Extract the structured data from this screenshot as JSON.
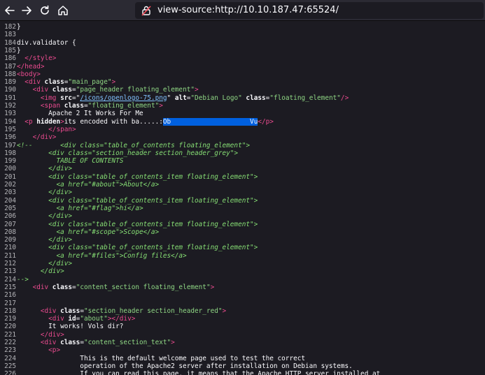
{
  "toolbar": {
    "back_icon": "arrow-left-icon",
    "forward_icon": "arrow-right-icon",
    "reload_icon": "reload-icon",
    "home_icon": "home-icon",
    "url": "view-source:http://10.10.187.47:65524/"
  },
  "source_lines": [
    {
      "n": "182",
      "segs": [
        {
          "t": "}"
        }
      ]
    },
    {
      "n": "183",
      "segs": []
    },
    {
      "n": "184",
      "segs": [
        {
          "t": "div.validator {"
        }
      ]
    },
    {
      "n": "185",
      "segs": [
        {
          "t": "}"
        }
      ]
    },
    {
      "n": "186",
      "segs": [
        {
          "t": "  "
        },
        {
          "t": "</style>",
          "c": "tag"
        }
      ]
    },
    {
      "n": "187",
      "segs": [
        {
          "t": "</head>",
          "c": "tag"
        }
      ]
    },
    {
      "n": "188",
      "segs": [
        {
          "t": "<body>",
          "c": "tag"
        }
      ]
    },
    {
      "n": "189",
      "segs": [
        {
          "t": "  "
        },
        {
          "t": "<div",
          "c": "tag"
        },
        {
          "t": " class",
          "c": "attr"
        },
        {
          "t": "="
        },
        {
          "t": "\"main_page\"",
          "c": "val"
        },
        {
          "t": ">",
          "c": "tag"
        }
      ]
    },
    {
      "n": "190",
      "segs": [
        {
          "t": "    "
        },
        {
          "t": "<div",
          "c": "tag"
        },
        {
          "t": " class",
          "c": "attr"
        },
        {
          "t": "="
        },
        {
          "t": "\"page_header floating_element\"",
          "c": "val"
        },
        {
          "t": ">",
          "c": "tag"
        }
      ]
    },
    {
      "n": "191",
      "segs": [
        {
          "t": "      "
        },
        {
          "t": "<img",
          "c": "tag"
        },
        {
          "t": " src",
          "c": "attr"
        },
        {
          "t": "=\""
        },
        {
          "t": "/icons/openlogo-75.png",
          "c": "link"
        },
        {
          "t": "\""
        },
        {
          "t": " alt",
          "c": "attr"
        },
        {
          "t": "="
        },
        {
          "t": "\"Debian Logo\"",
          "c": "val"
        },
        {
          "t": " class",
          "c": "attr"
        },
        {
          "t": "="
        },
        {
          "t": "\"floating_element\"",
          "c": "val"
        },
        {
          "t": "/>",
          "c": "tag"
        }
      ]
    },
    {
      "n": "192",
      "segs": [
        {
          "t": "      "
        },
        {
          "t": "<span",
          "c": "tag"
        },
        {
          "t": " class",
          "c": "attr"
        },
        {
          "t": "="
        },
        {
          "t": "\"floating_element\"",
          "c": "val"
        },
        {
          "t": ">",
          "c": "tag"
        }
      ]
    },
    {
      "n": "193",
      "segs": [
        {
          "t": "        Apache 2 It Works For Me"
        }
      ]
    },
    {
      "n": "194",
      "segs": [
        {
          "t": "  "
        },
        {
          "t": "<p",
          "c": "tag"
        },
        {
          "t": " hidden",
          "c": "attr"
        },
        {
          "t": ">",
          "c": "tag"
        },
        {
          "t": "its encoded with ba.....:"
        },
        {
          "t": "Ob                    Vu",
          "c": "hl"
        },
        {
          "t": "</p>",
          "c": "tag"
        }
      ]
    },
    {
      "n": "195",
      "segs": [
        {
          "t": "        "
        },
        {
          "t": "</span>",
          "c": "tag"
        }
      ]
    },
    {
      "n": "196",
      "segs": [
        {
          "t": "    "
        },
        {
          "t": "</div>",
          "c": "tag"
        }
      ]
    },
    {
      "n": "197",
      "segs": [
        {
          "t": "<!--       <div class=\"table_of_contents floating_element\">",
          "c": "cmt"
        }
      ]
    },
    {
      "n": "198",
      "segs": [
        {
          "t": "        <div class=\"section_header section_header_grey\">",
          "c": "cmt"
        }
      ]
    },
    {
      "n": "199",
      "segs": [
        {
          "t": "          TABLE OF CONTENTS",
          "c": "cmt"
        }
      ]
    },
    {
      "n": "200",
      "segs": [
        {
          "t": "        </div>",
          "c": "cmt"
        }
      ]
    },
    {
      "n": "201",
      "segs": [
        {
          "t": "        <div class=\"table_of_contents_item floating_element\">",
          "c": "cmt"
        }
      ]
    },
    {
      "n": "202",
      "segs": [
        {
          "t": "          <a href=\"#about\">About</a>",
          "c": "cmt"
        }
      ]
    },
    {
      "n": "203",
      "segs": [
        {
          "t": "        </div>",
          "c": "cmt"
        }
      ]
    },
    {
      "n": "204",
      "segs": [
        {
          "t": "        <div class=\"table_of_contents_item floating_element\">",
          "c": "cmt"
        }
      ]
    },
    {
      "n": "205",
      "segs": [
        {
          "t": "          <a href=\"#flag\">hi</a>",
          "c": "cmt"
        }
      ]
    },
    {
      "n": "206",
      "segs": [
        {
          "t": "        </div>",
          "c": "cmt"
        }
      ]
    },
    {
      "n": "207",
      "segs": [
        {
          "t": "        <div class=\"table_of_contents_item floating_element\">",
          "c": "cmt"
        }
      ]
    },
    {
      "n": "208",
      "segs": [
        {
          "t": "          <a href=\"#scope\">Scope</a>",
          "c": "cmt"
        }
      ]
    },
    {
      "n": "209",
      "segs": [
        {
          "t": "        </div>",
          "c": "cmt"
        }
      ]
    },
    {
      "n": "210",
      "segs": [
        {
          "t": "        <div class=\"table_of_contents_item floating_element\">",
          "c": "cmt"
        }
      ]
    },
    {
      "n": "211",
      "segs": [
        {
          "t": "          <a href=\"#files\">Config files</a>",
          "c": "cmt"
        }
      ]
    },
    {
      "n": "212",
      "segs": [
        {
          "t": "        </div>",
          "c": "cmt"
        }
      ]
    },
    {
      "n": "213",
      "segs": [
        {
          "t": "      </div>",
          "c": "cmt"
        }
      ]
    },
    {
      "n": "214",
      "segs": [
        {
          "t": "-->",
          "c": "cmt"
        }
      ]
    },
    {
      "n": "215",
      "segs": [
        {
          "t": "    "
        },
        {
          "t": "<div",
          "c": "tag"
        },
        {
          "t": " class",
          "c": "attr"
        },
        {
          "t": "="
        },
        {
          "t": "\"content_section floating_element\"",
          "c": "val"
        },
        {
          "t": ">",
          "c": "tag"
        }
      ]
    },
    {
      "n": "216",
      "segs": []
    },
    {
      "n": "217",
      "segs": []
    },
    {
      "n": "218",
      "segs": [
        {
          "t": "      "
        },
        {
          "t": "<div",
          "c": "tag"
        },
        {
          "t": " class",
          "c": "attr"
        },
        {
          "t": "="
        },
        {
          "t": "\"section_header section_header_red\"",
          "c": "val"
        },
        {
          "t": ">",
          "c": "tag"
        }
      ]
    },
    {
      "n": "219",
      "segs": [
        {
          "t": "        "
        },
        {
          "t": "<div",
          "c": "tag"
        },
        {
          "t": " id",
          "c": "attr"
        },
        {
          "t": "="
        },
        {
          "t": "\"about\"",
          "c": "val"
        },
        {
          "t": "></div>",
          "c": "tag"
        }
      ]
    },
    {
      "n": "220",
      "segs": [
        {
          "t": "        It works! Vols dir?"
        }
      ]
    },
    {
      "n": "221",
      "segs": [
        {
          "t": "      "
        },
        {
          "t": "</div>",
          "c": "tag"
        }
      ]
    },
    {
      "n": "222",
      "segs": [
        {
          "t": "      "
        },
        {
          "t": "<div",
          "c": "tag"
        },
        {
          "t": " class",
          "c": "attr"
        },
        {
          "t": "="
        },
        {
          "t": "\"content_section_text\"",
          "c": "val"
        },
        {
          "t": ">",
          "c": "tag"
        }
      ]
    },
    {
      "n": "223",
      "segs": [
        {
          "t": "        "
        },
        {
          "t": "<p>",
          "c": "tag"
        }
      ]
    },
    {
      "n": "224",
      "segs": [
        {
          "t": "                This is the default welcome page used to test the correct"
        }
      ]
    },
    {
      "n": "225",
      "segs": [
        {
          "t": "                operation of the Apache2 server after installation on Debian systems."
        }
      ]
    },
    {
      "n": "226",
      "segs": [
        {
          "t": "                If you can read this page, it means that the Apache HTTP server installed at"
        }
      ]
    }
  ]
}
